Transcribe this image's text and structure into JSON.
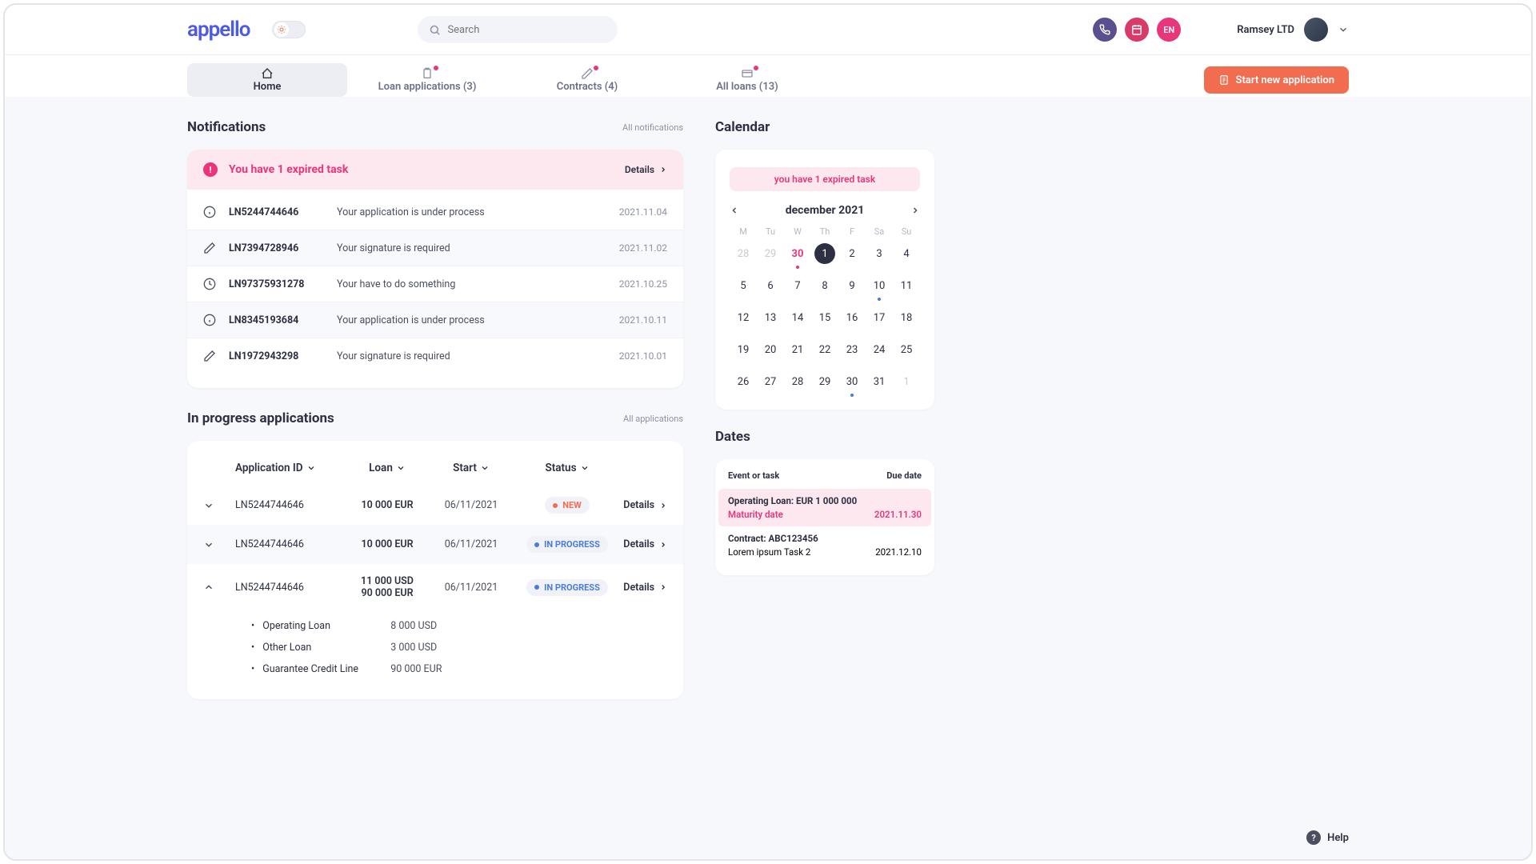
{
  "header": {
    "logo": "appello",
    "search_placeholder": "Search",
    "language": "EN",
    "company": "Ramsey LTD"
  },
  "tabs": {
    "home": "Home",
    "loan_apps": "Loan applications (3)",
    "contracts": "Contracts (4)",
    "all_loans": "All loans (13)",
    "start_new": "Start new application"
  },
  "notifications": {
    "title": "Notifications",
    "link": "All notifications",
    "alert": "You have 1 expired task",
    "alert_details": "Details",
    "items": [
      {
        "icon": "info",
        "id": "LN5244744646",
        "msg": "Your application is under process",
        "date": "2021.11.04"
      },
      {
        "icon": "edit",
        "id": "LN7394728946",
        "msg": "Your signature is required",
        "date": "2021.11.02"
      },
      {
        "icon": "clock",
        "id": "LN97375931278",
        "msg": "Your have to do something",
        "date": "2021.10.25"
      },
      {
        "icon": "info",
        "id": "LN8345193684",
        "msg": "Your application is under process",
        "date": "2021.10.11"
      },
      {
        "icon": "edit",
        "id": "LN1972943298",
        "msg": "Your signature is required",
        "date": "2021.10.01"
      }
    ]
  },
  "apps": {
    "title": "In progress applications",
    "link": "All applications",
    "cols": {
      "id": "Application ID",
      "loan": "Loan",
      "start": "Start",
      "status": "Status"
    },
    "details_label": "Details",
    "rows": [
      {
        "exp": "down",
        "id": "LN5244744646",
        "loan": "10 000 EUR",
        "start": "06/11/2021",
        "status": "NEW",
        "kind": "new"
      },
      {
        "exp": "down",
        "id": "LN5244744646",
        "loan": "10 000 EUR",
        "start": "06/11/2021",
        "status": "IN PROGRESS",
        "kind": "prog"
      },
      {
        "exp": "up",
        "id": "LN5244744646",
        "loan": "11 000 USD\n90 000 EUR",
        "start": "06/11/2021",
        "status": "IN PROGRESS",
        "kind": "prog"
      }
    ],
    "sub": [
      {
        "name": "Operating Loan",
        "val": "8 000 USD"
      },
      {
        "name": "Other Loan",
        "val": "3 000 USD"
      },
      {
        "name": "Guarantee Credit Line",
        "val": "90 000 EUR"
      }
    ]
  },
  "calendar": {
    "title": "Calendar",
    "alert": "you have 1 expired task",
    "month": "december 2021",
    "dow": [
      "M",
      "Tu",
      "W",
      "Th",
      "F",
      "Sa",
      "Su"
    ]
  },
  "dates": {
    "title": "Dates",
    "head_event": "Event or task",
    "head_due": "Due date",
    "items": [
      {
        "title": "Operating Loan: EUR 1 000 000",
        "label": "Maturity date",
        "due": "2021.11.30",
        "pink": true
      },
      {
        "title": "Contract: ABC123456",
        "label": "Lorem ipsum Task 2",
        "due": "2021.12.10",
        "pink": false
      }
    ]
  },
  "help": "Help"
}
